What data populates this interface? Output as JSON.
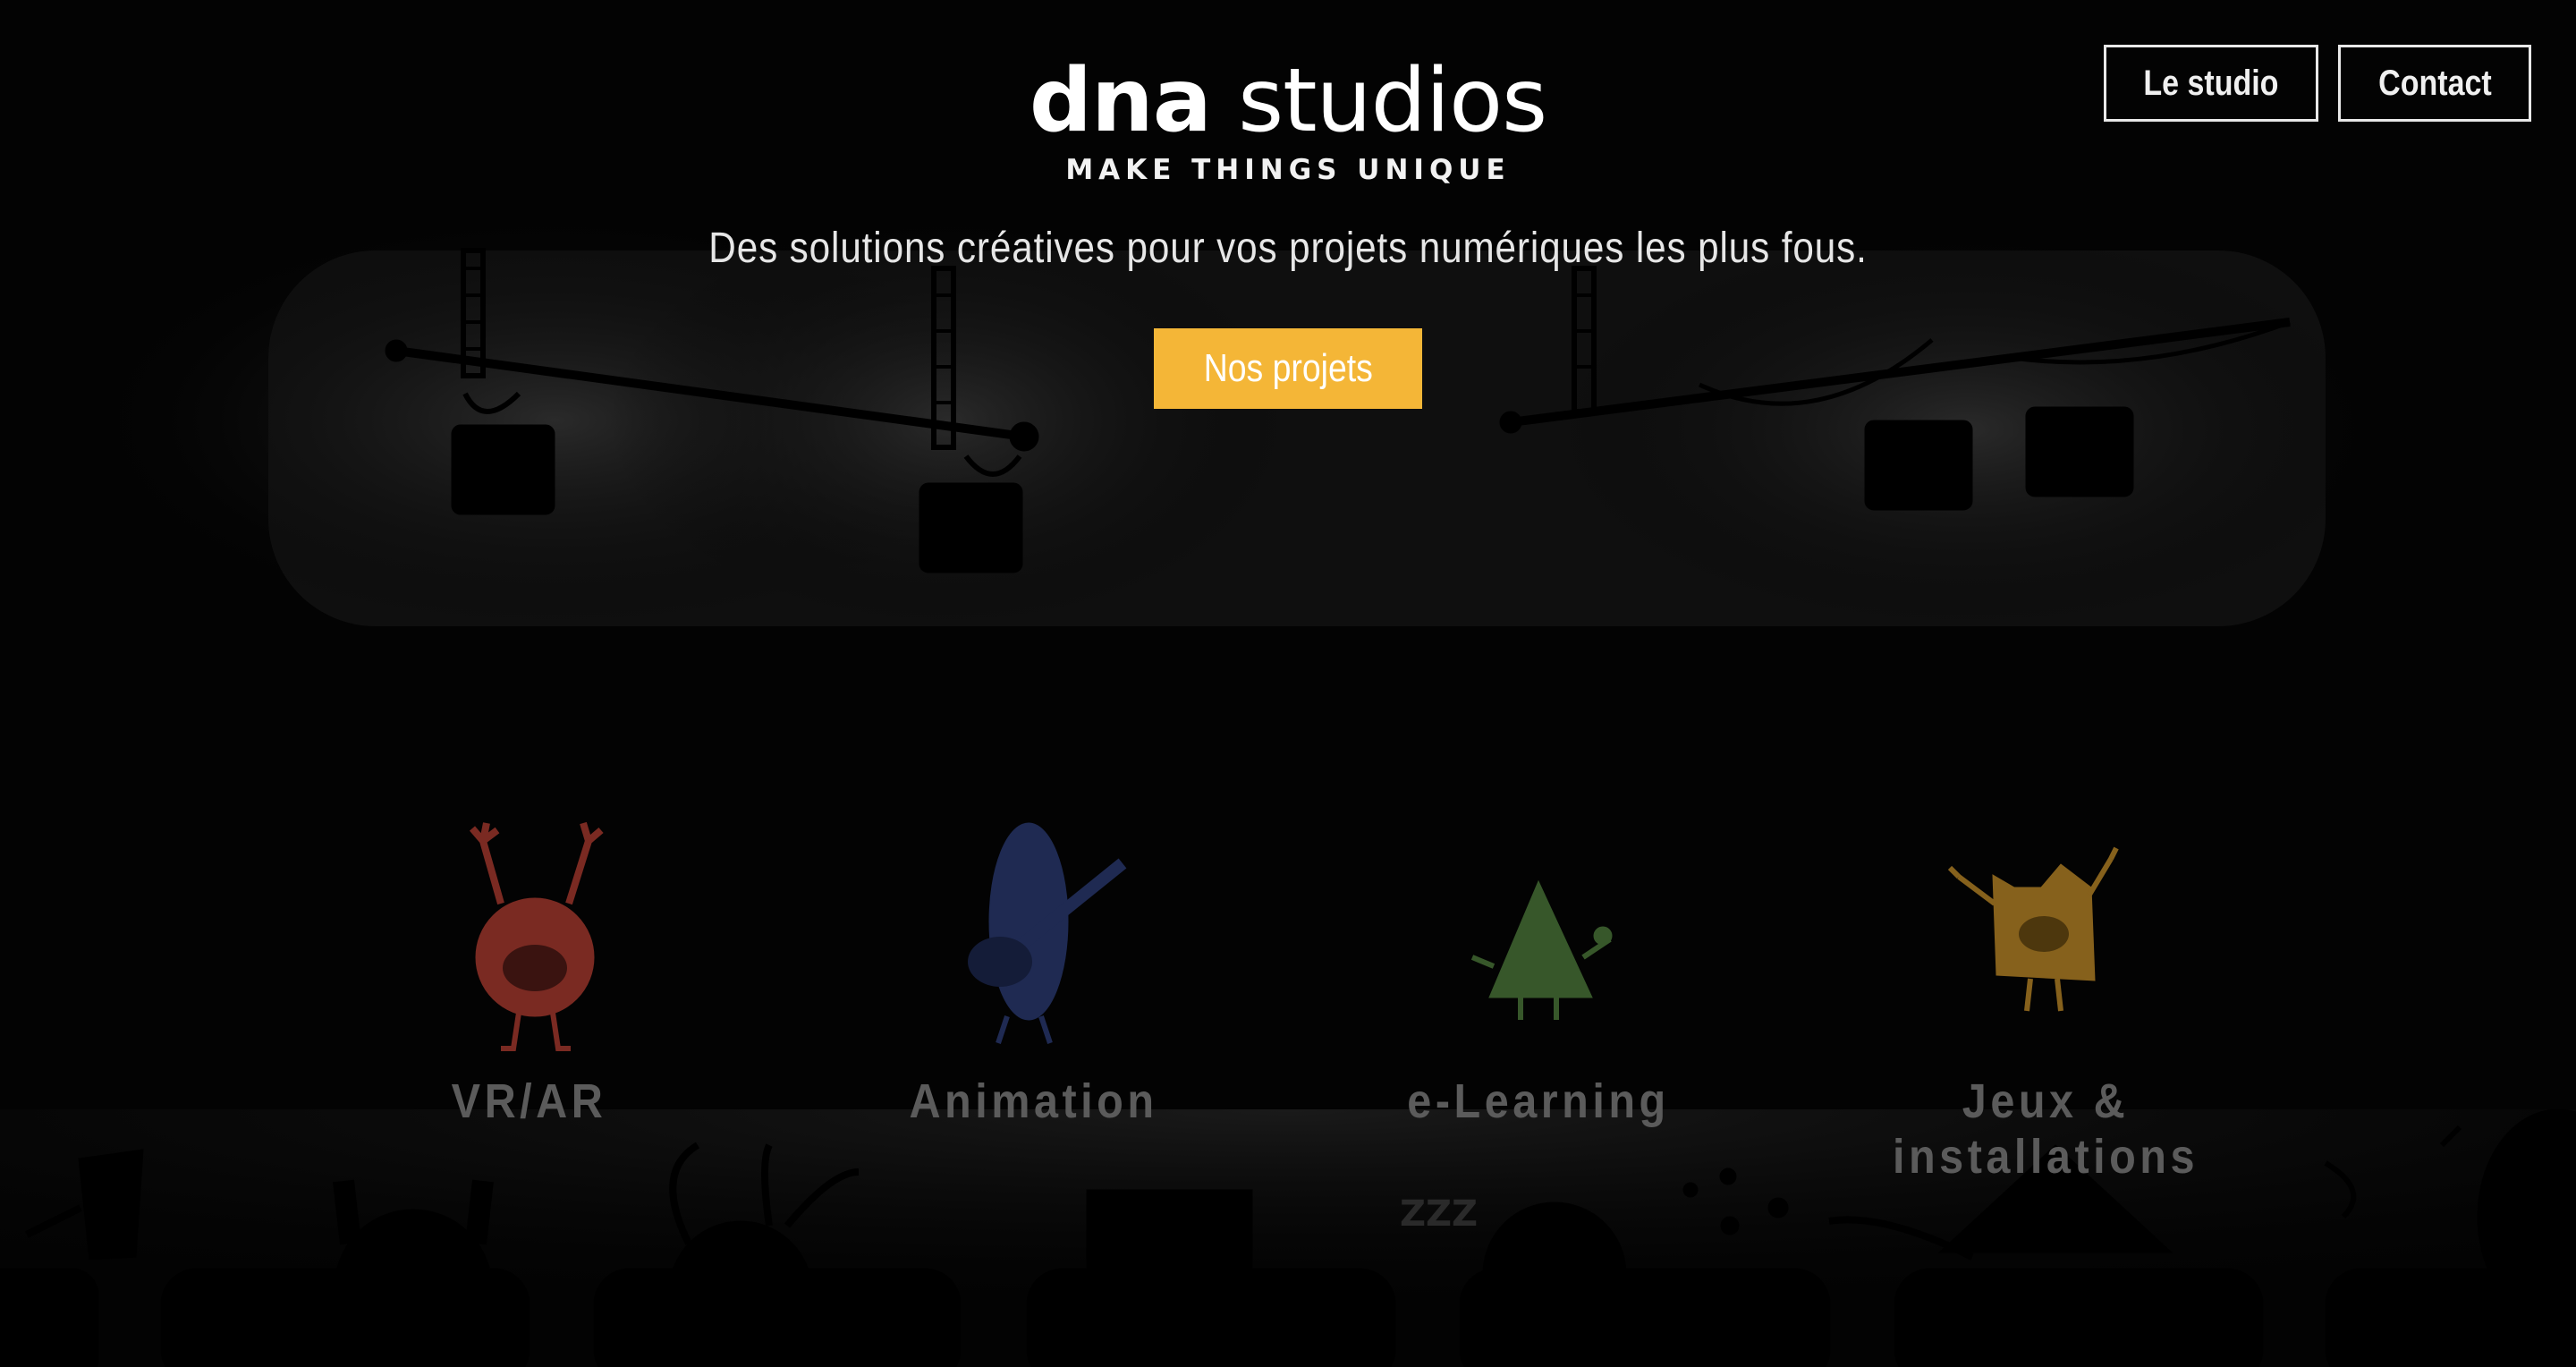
{
  "header": {
    "logo_bold": "dna",
    "logo_light": "studios",
    "tagline": "MAKE THINGS UNIQUE"
  },
  "nav": {
    "studio_label": "Le studio",
    "contact_label": "Contact"
  },
  "hero": {
    "subtitle": "Des solutions créatives pour vos projets numériques les plus fous.",
    "cta_label": "Nos projets"
  },
  "categories": [
    {
      "label": "VR/AR",
      "icon": "red-monster-icon",
      "color": "#7a2a22"
    },
    {
      "label": "Animation",
      "icon": "blue-guitarist-icon",
      "color": "#1f2a52"
    },
    {
      "label": "e-Learning",
      "icon": "green-triangle-icon",
      "color": "#37572a"
    },
    {
      "label": "Jeux & installations",
      "icon": "orange-square-monster-icon",
      "color": "#86611c"
    }
  ],
  "audience": {
    "sleep_text": "ZZZ"
  },
  "colors": {
    "accent": "#f4b637",
    "background": "#030303",
    "label": "#5b5b5b"
  }
}
